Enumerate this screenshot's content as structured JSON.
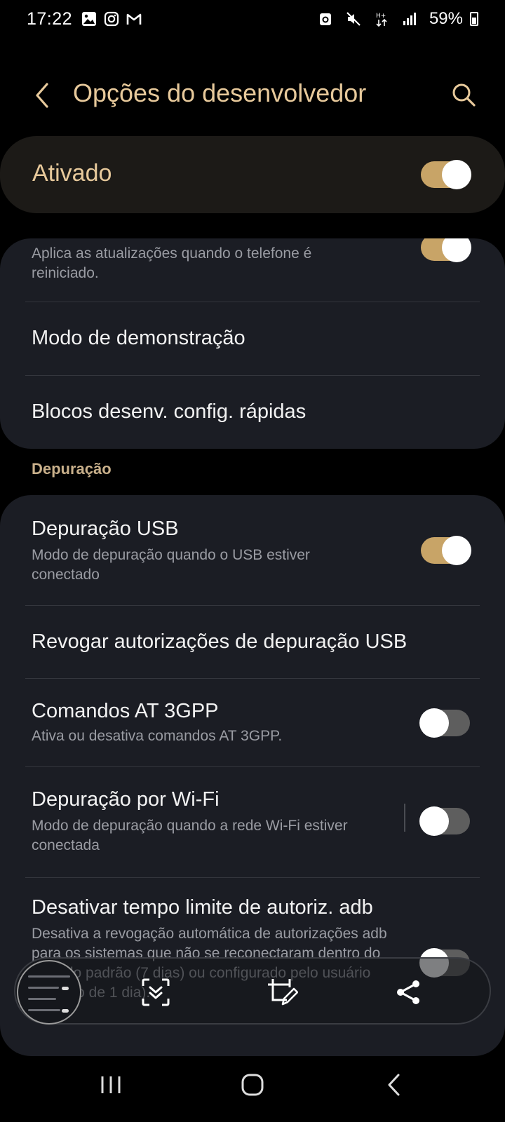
{
  "status_bar": {
    "time": "17:22",
    "battery": "59%",
    "left_icons": [
      "gallery-icon",
      "instagram-icon",
      "gmail-icon"
    ],
    "right_icons": [
      "nfc-icon",
      "mute-icon",
      "data-hplus-icon",
      "signal-icon",
      "battery-icon"
    ]
  },
  "header": {
    "title": "Opções do desenvolvedor"
  },
  "master": {
    "label": "Ativado",
    "on": true
  },
  "card1": {
    "items": [
      {
        "subtitle": "Aplica as atualizações quando o telefone é reiniciado.",
        "toggle": "on"
      },
      {
        "title": "Modo de demonstração"
      },
      {
        "title": "Blocos desenv. config. rápidas"
      }
    ]
  },
  "section": {
    "title": "Depuração"
  },
  "card2": {
    "items": [
      {
        "title": "Depuração USB",
        "subtitle": "Modo de depuração quando o USB estiver conectado",
        "toggle": "on"
      },
      {
        "title": "Revogar autorizações de depuração USB"
      },
      {
        "title": "Comandos AT 3GPP",
        "subtitle": "Ativa ou desativa comandos AT 3GPP.",
        "toggle": "off"
      },
      {
        "title": "Depuração por Wi-Fi",
        "subtitle": "Modo de depuração quando a rede Wi-Fi estiver conectada",
        "toggle": "off"
      },
      {
        "title": "Desativar tempo limite de autoriz. adb",
        "subtitle": "Desativa a revogação automática de autorizações adb para os sistemas que não se reconectaram dentro do período padrão (7 dias) ou configurado pelo usuário (mínimo de 1 dia).",
        "toggle": "off"
      }
    ]
  },
  "screenshot_toolbar": {
    "tools": [
      "scroll-capture-icon",
      "crop-edit-icon",
      "share-icon"
    ]
  },
  "nav": {
    "buttons": [
      "recents-icon",
      "home-icon",
      "back-icon"
    ]
  },
  "colors": {
    "accent": "#e7c99b",
    "toggle_on": "#c8a467",
    "card_bg": "#1b1d24",
    "background": "#000000"
  }
}
